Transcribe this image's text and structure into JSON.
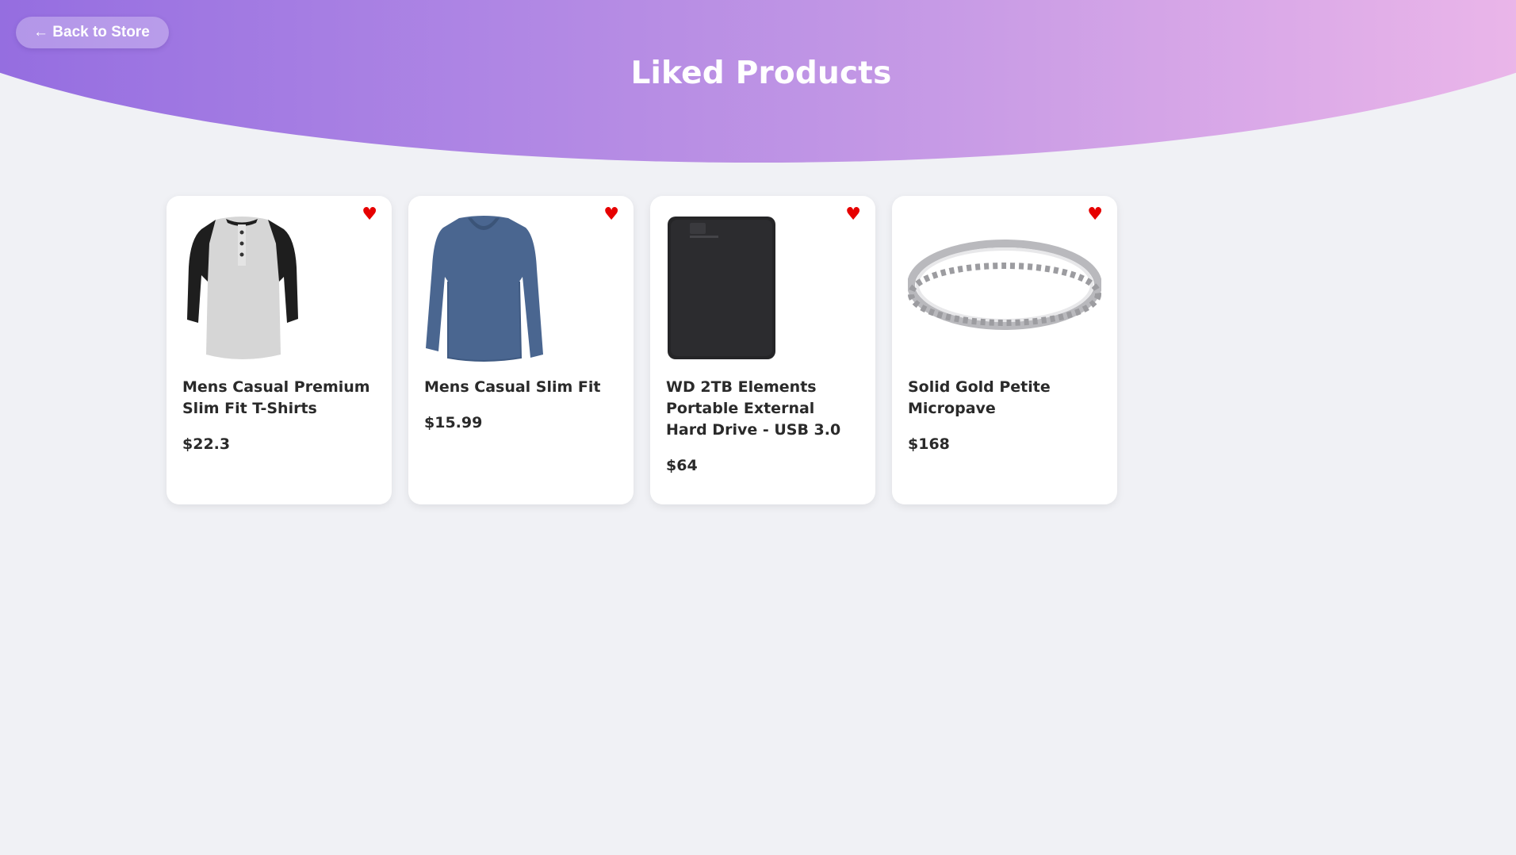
{
  "header": {
    "back_label": "← Back to Store",
    "title": "Liked Products"
  },
  "products": [
    {
      "name": "Mens Casual Premium Slim Fit T-Shirts",
      "price": "$22.3",
      "icon": "tshirt-image",
      "liked_icon": "♥"
    },
    {
      "name": "Mens Casual Slim Fit",
      "price": "$15.99",
      "icon": "sweater-image",
      "liked_icon": "♥"
    },
    {
      "name": "WD 2TB Elements Portable External Hard Drive - USB 3.0",
      "price": "$64",
      "icon": "hard-drive-image",
      "liked_icon": "♥"
    },
    {
      "name": "Solid Gold Petite Micropave",
      "price": "$168",
      "icon": "ring-image",
      "liked_icon": "♥"
    }
  ],
  "colors": {
    "gradient_start": "#8d66df",
    "gradient_end": "#f3bdea",
    "heart": "#e60000",
    "background": "#f0f1f5"
  }
}
